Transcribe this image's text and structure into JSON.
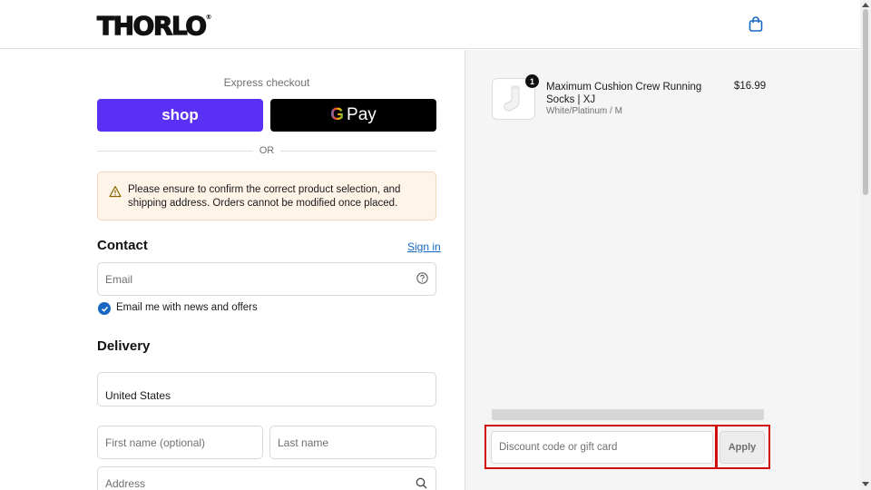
{
  "header": {
    "logo": "THORLO",
    "logo_mark": "®",
    "cart_icon": "shopping-bag-icon"
  },
  "express": {
    "label": "Express checkout",
    "shop_label": "shop",
    "gpay_g": "G",
    "gpay_label": "Pay",
    "or": "OR"
  },
  "notice": {
    "icon": "warning-icon",
    "text": "Please ensure to confirm the correct product selection, and shipping address. Orders cannot be modified once placed."
  },
  "contact": {
    "heading": "Contact",
    "signin": "Sign in",
    "email_placeholder": "Email",
    "help_icon": "help-circle-icon",
    "newsletter_label": "Email me with news and offers",
    "newsletter_checked": true
  },
  "delivery": {
    "heading": "Delivery",
    "country": "United States",
    "first_name_placeholder": "First name (optional)",
    "last_name_placeholder": "Last name",
    "address_placeholder": "Address",
    "search_icon": "search-icon"
  },
  "summary": {
    "item": {
      "quantity": "1",
      "name": "Maximum Cushion Crew Running Socks | XJ",
      "variant": "White/Platinum / M",
      "price": "$16.99"
    },
    "discount_placeholder": "Discount code or gift card",
    "apply_label": "Apply"
  },
  "colors": {
    "shop_brand": "#5a31f4",
    "link": "#1667c2",
    "highlight": "#d20a0a",
    "notice_bg": "#fff4e8"
  }
}
